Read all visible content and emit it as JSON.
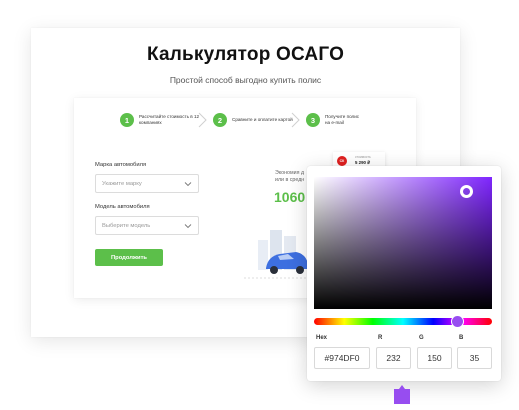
{
  "header": {
    "title": "Калькулятор ОСАГО",
    "subtitle": "Простой способ выгодно купить полис"
  },
  "steps": [
    {
      "num": "1",
      "text": "Рассчитайте стоимость в 12 компаниях"
    },
    {
      "num": "2",
      "text": "Сравните и оплатите картой"
    },
    {
      "num": "3",
      "text": "Получите полис на e-mail"
    }
  ],
  "form": {
    "brand_label": "Марка автомобиля",
    "brand_placeholder": "Укажите марку",
    "model_label": "Модель автомобиля",
    "model_placeholder": "Выберите модель",
    "submit_label": "Продолжить"
  },
  "savings": {
    "line1": "Экономия д",
    "line2": "или в средн",
    "amount": "1060"
  },
  "price_card": {
    "logo": "СК",
    "label": "стоимость",
    "price": "5 290 ₽"
  },
  "color_picker": {
    "hex_label": "Hex",
    "r_label": "R",
    "g_label": "G",
    "b_label": "B",
    "hex_value": "#974DF0",
    "r_value": "232",
    "g_value": "150",
    "b_value": "35",
    "swatch_color": "#974DF0",
    "accent_color": "#5cbf4a"
  }
}
